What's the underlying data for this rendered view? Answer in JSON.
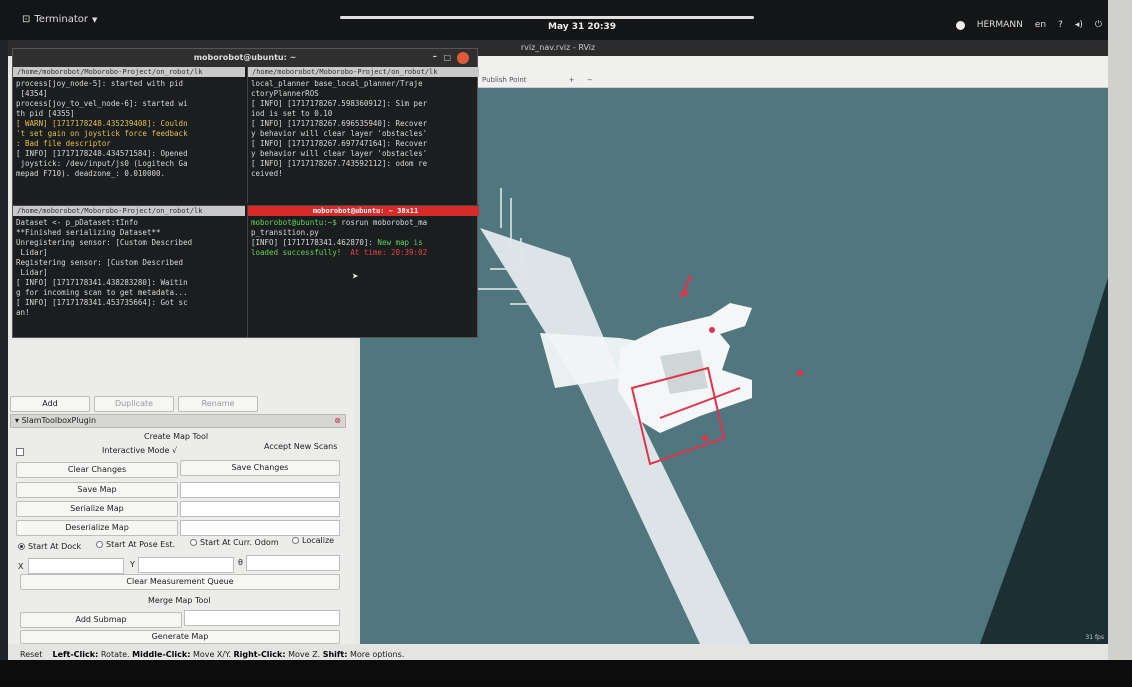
{
  "topbar": {
    "app_name": "Terminator",
    "clock": "May 31  20:39",
    "user": "HERMANN",
    "lang": "en"
  },
  "rviz": {
    "title": "rviz_nav.rviz - RViz",
    "toolbar_item": "Publish Point",
    "status": {
      "reset": "Reset",
      "text_lc": "Left-Click:",
      "text_lc_v": "Rotate.",
      "text_mc": "Middle-Click:",
      "text_mc_v": "Move X/Y.",
      "text_rc": "Right-Click:",
      "text_rc_v": "Move Z.",
      "text_shift": "Shift:",
      "text_shift_v": "More options."
    },
    "fps": "31 fps"
  },
  "panel": {
    "add": "Add",
    "duplicate": "Duplicate",
    "rename": "Rename",
    "plugin_title": "SlamToolboxPlugin",
    "create_map_tool": "Create Map Tool",
    "interactive_mode": "Interactive Mode",
    "accept_new_scans": "Accept New Scans",
    "clear_changes": "Clear Changes",
    "save_changes": "Save Changes",
    "save_map": "Save Map",
    "serialize_map": "Serialize Map",
    "deserialize_map": "Deserialize Map",
    "start_at_dock": "Start At Dock",
    "start_at_pose": "Start At Pose Est.",
    "start_at_curr": "Start At Curr. Odom",
    "localize": "Localize",
    "x_label": "X",
    "y_label": "Y",
    "theta_label": "θ",
    "clear_measurement": "Clear Measurement Queue",
    "merge_map_tool": "Merge Map Tool",
    "add_submap": "Add Submap",
    "generate_map": "Generate Map"
  },
  "terminal": {
    "title": "moborobot@ubuntu: ~",
    "pane1_header": "/home/moborobot/Moborobo-Project/on_robot/lk",
    "pane1_lines": [
      "process[joy_node-5]: started with pid",
      " [4354]",
      "process[joy_to_vel_node-6]: started wi",
      "th pid [4355]",
      "[ WARN] [1717178248.435239408]: Couldn",
      "'t set gain on joystick force feedback",
      ": Bad file descriptor",
      "[ INFO] [1717178248.434571584]: Opened",
      " joystick: /dev/input/js0 (Logitech Ga",
      "mepad F710). deadzone_: 0.010000."
    ],
    "pane2_header": "/home/moborobot/Moborobo-Project/on_robot/lk",
    "pane2_lines": [
      "local_planner base_local_planner/Traje",
      "ctoryPlannerROS",
      "[ INFO] [1717178267.598360912]: Sim per",
      "iod is set to 0.10",
      "[ INFO] [1717178267.696535940]: Recover",
      "y behavior will clear layer 'obstacles'",
      "[ INFO] [1717178267.697747164]: Recover",
      "y behavior will clear layer 'obstacles'",
      "[ INFO] [1717178267.743592112]: odom re",
      "ceived!"
    ],
    "pane3_header": "/home/moborobot/Moborobo-Project/on_robot/lk",
    "pane3_lines": [
      "Dataset <- p_pDataset:tInfo",
      "**Finished serializing Dataset**",
      "Unregistering sensor: [Custom Described",
      " Lidar]",
      "Registering sensor: [Custom Described",
      " Lidar]",
      "[ INFO] [1717178341.438283280]: Waitin",
      "g for incoming scan to get metadata...",
      "[ INFO] [1717178341.453735664]: Got sc",
      "an!"
    ],
    "pane4_header": "moborobot@ubuntu: ~ 38x11",
    "pane4_prompt": "moborobot@ubuntu:~$",
    "pane4_cmd": " rosrun moborobot_ma",
    "pane4_cmd2": "p_transition.py",
    "pane4_info": "[INFO] [1717178341.462870]:",
    "pane4_ok": " New map is",
    "pane4_ok2": "loaded successfully!",
    "pane4_time": "  At time: 20:39:02"
  }
}
